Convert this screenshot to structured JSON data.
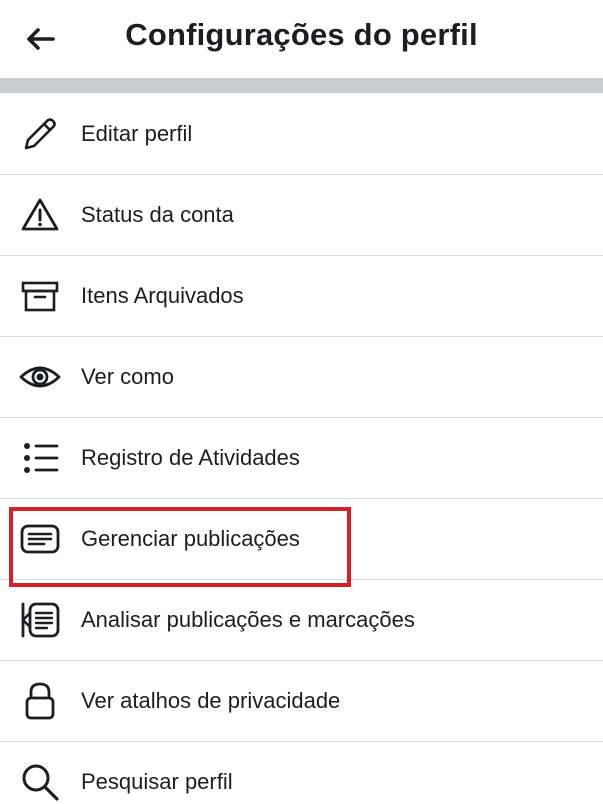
{
  "header": {
    "title": "Configurações do perfil",
    "back_icon": "arrow-left-icon"
  },
  "menu": {
    "items": [
      {
        "label": "Editar perfil",
        "icon": "pencil-icon"
      },
      {
        "label": "Status da conta",
        "icon": "warning-icon"
      },
      {
        "label": "Itens Arquivados",
        "icon": "archive-icon"
      },
      {
        "label": "Ver como",
        "icon": "eye-icon"
      },
      {
        "label": "Registro de Atividades",
        "icon": "list-icon"
      },
      {
        "label": "Gerenciar publicações",
        "icon": "posts-icon"
      },
      {
        "label": "Analisar publicações e marcações",
        "icon": "review-posts-icon"
      },
      {
        "label": "Ver atalhos de privacidade",
        "icon": "lock-icon"
      },
      {
        "label": "Pesquisar perfil",
        "icon": "search-icon"
      }
    ]
  },
  "colors": {
    "highlight": "#d81f26",
    "separator": "#c9ccd1",
    "divider": "#dadde1",
    "text": "#1c1e21"
  }
}
